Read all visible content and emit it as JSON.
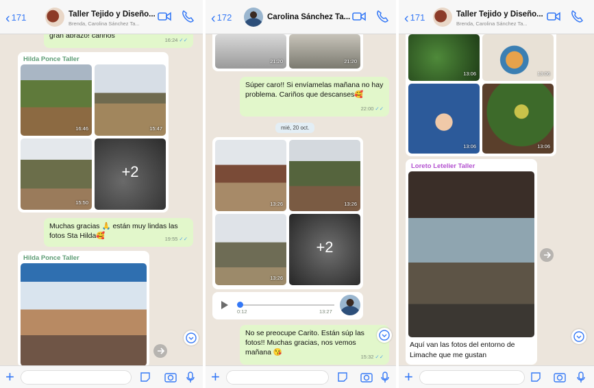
{
  "colors": {
    "accent": "#3478f6",
    "outgoing": "#e2f7cb",
    "sender_green": "#5c9c74",
    "sender_purple": "#b24fcf",
    "read_tick": "#4fa3e6"
  },
  "panel1": {
    "back_count": "171",
    "title": "Taller Tejido y Diseño...",
    "subtitle": "Brenda, Carolina Sánchez Ta...",
    "top_message": {
      "text": "gran abrazo! cariños",
      "time": "16:24"
    },
    "album1": {
      "sender": "Hilda Ponce Taller",
      "times": [
        "16:46",
        "15:47",
        "15:50"
      ],
      "more": "+2"
    },
    "thanks": {
      "text": "Muchas gracias 🙏 están muy lindas las fotos Sta Hilda🥰",
      "time": "19:55"
    },
    "album2": {
      "sender": "Hilda Ponce Taller"
    }
  },
  "panel2": {
    "back_count": "172",
    "title": "Carolina Sánchez Ta...",
    "top_times": [
      "21:20",
      "21:20"
    ],
    "msg1": {
      "text": "Súper caro!! Si envíamelas mañana no hay problema. Cariños que descanses🥰",
      "time": "22:00"
    },
    "day": "mié, 20 oct.",
    "album": {
      "times": [
        "13:26",
        "13:26",
        "13:26"
      ],
      "more": "+2"
    },
    "voice": {
      "duration": "0:12",
      "time": "13:27"
    },
    "msg2": {
      "text": "No se preocupe Carito. Están súp las fotos!! Muchas gracias, nos vemos mañana 😘",
      "time": "15:32"
    }
  },
  "panel3": {
    "back_count": "171",
    "title": "Taller Tejido y Diseño...",
    "subtitle": "Brenda, Carolina Sánchez Ta...",
    "grid_times": [
      "13:06",
      "13:06",
      "13:06",
      "13:06"
    ],
    "post": {
      "sender": "Loreto Letelier Taller",
      "caption": "Aquí van las fotos del entorno de Limache que me gustan"
    }
  },
  "icons": [
    "back-chevron-icon",
    "video-call-icon",
    "phone-icon",
    "plus-icon",
    "sticker-icon",
    "camera-icon",
    "microphone-icon",
    "scroll-down-icon",
    "forward-icon",
    "play-icon"
  ]
}
